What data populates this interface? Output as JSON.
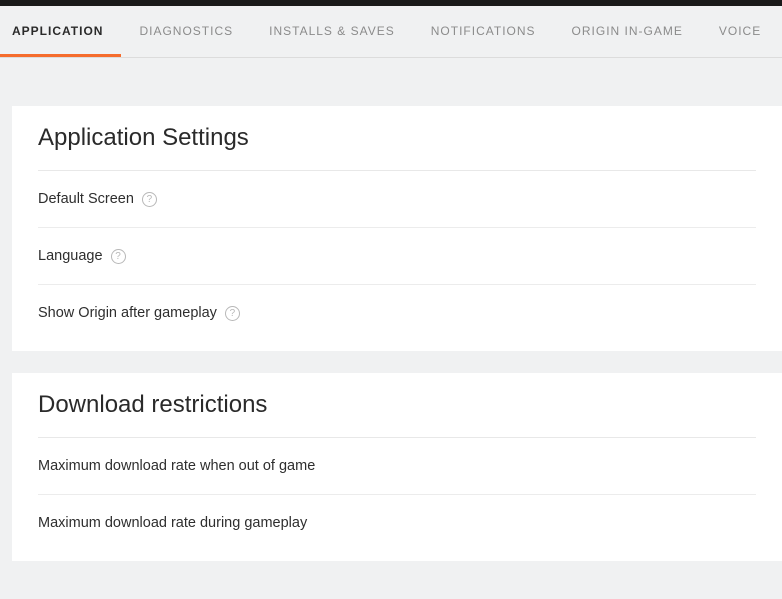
{
  "tabs": [
    {
      "label": "APPLICATION",
      "active": true
    },
    {
      "label": "DIAGNOSTICS",
      "active": false
    },
    {
      "label": "INSTALLS & SAVES",
      "active": false
    },
    {
      "label": "NOTIFICATIONS",
      "active": false
    },
    {
      "label": "ORIGIN IN-GAME",
      "active": false
    },
    {
      "label": "VOICE",
      "active": false
    }
  ],
  "sections": {
    "app": {
      "title": "Application Settings",
      "rows": [
        {
          "label": "Default Screen",
          "help": true
        },
        {
          "label": "Language",
          "help": true
        },
        {
          "label": "Show Origin after gameplay",
          "help": true
        }
      ]
    },
    "download": {
      "title": "Download restrictions",
      "rows": [
        {
          "label": "Maximum download rate when out of game",
          "help": false
        },
        {
          "label": "Maximum download rate during gameplay",
          "help": false
        }
      ]
    }
  }
}
